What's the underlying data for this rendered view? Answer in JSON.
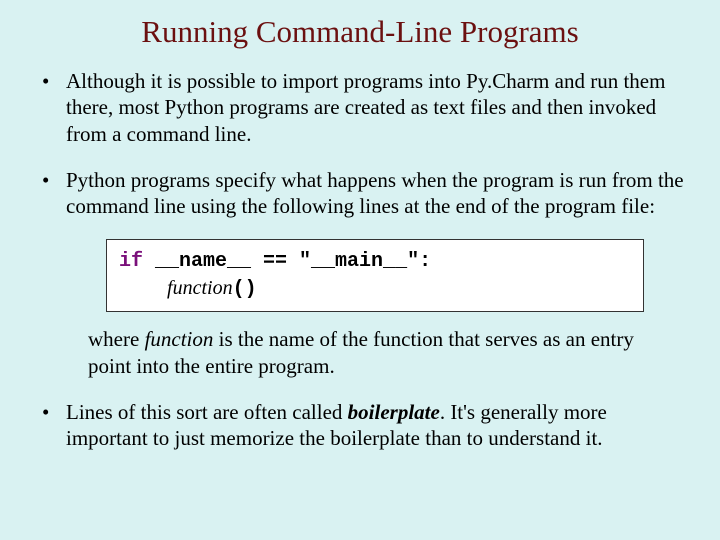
{
  "title": "Running Command-Line Programs",
  "bullets": {
    "b1": "Although it is possible to import programs into Py.Charm and run them there, most Python programs are created as text files and then invoked from a command line.",
    "b2": "Python programs specify what happens when the program is run from the command line using the following lines at the end of the program file:",
    "b3_pre": "Lines of this sort are often called ",
    "b3_term": "boilerplate",
    "b3_post": ".  It's generally more important to just memorize the boilerplate than to understand it."
  },
  "code": {
    "kw_if": "if",
    "name": " __name__ == ",
    "main_str": "\"__main__\"",
    "colon": ":",
    "indent": "    ",
    "fn": "function",
    "parens": "()"
  },
  "expl": {
    "pre": "where ",
    "fn": "function",
    "post": " is the name of the function that serves as an entry point into the entire program."
  }
}
